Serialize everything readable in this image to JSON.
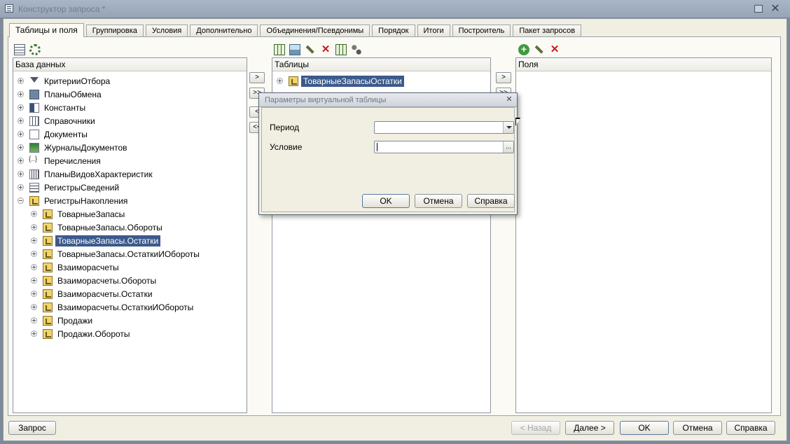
{
  "window": {
    "title": "Конструктор запроса *",
    "close_glyph": "✕"
  },
  "tabs": [
    {
      "label": "Таблицы и поля"
    },
    {
      "label": "Группировка"
    },
    {
      "label": "Условия"
    },
    {
      "label": "Дополнительно"
    },
    {
      "label": "Объединения/Псевдонимы"
    },
    {
      "label": "Порядок"
    },
    {
      "label": "Итоги"
    },
    {
      "label": "Построитель"
    },
    {
      "label": "Пакет запросов"
    }
  ],
  "database_panel": {
    "header": "База данных",
    "items": [
      {
        "label": "КритерииОтбора",
        "icon": "filter-icon"
      },
      {
        "label": "ПланыОбмена",
        "icon": "exchange-plan-icon"
      },
      {
        "label": "Константы",
        "icon": "constants-icon"
      },
      {
        "label": "Справочники",
        "icon": "catalog-icon"
      },
      {
        "label": "Документы",
        "icon": "document-icon"
      },
      {
        "label": "ЖурналыДокументов",
        "icon": "journal-icon"
      },
      {
        "label": "Перечисления",
        "icon": "enum-icon"
      },
      {
        "label": "ПланыВидовХарактеристик",
        "icon": "characteristic-types-icon"
      },
      {
        "label": "РегистрыСведений",
        "icon": "info-register-icon"
      },
      {
        "label": "РегистрыНакопления",
        "icon": "accumulation-register-icon"
      },
      {
        "label": "ТоварныеЗапасы",
        "icon": "accumulation-register-icon"
      },
      {
        "label": "ТоварныеЗапасы.Обороты",
        "icon": "accumulation-register-icon"
      },
      {
        "label": "ТоварныеЗапасы.Остатки",
        "icon": "accumulation-register-icon"
      },
      {
        "label": "ТоварныеЗапасы.ОстаткиИОбороты",
        "icon": "accumulation-register-icon"
      },
      {
        "label": "Взаиморасчеты",
        "icon": "accumulation-register-icon"
      },
      {
        "label": "Взаиморасчеты.Обороты",
        "icon": "accumulation-register-icon"
      },
      {
        "label": "Взаиморасчеты.Остатки",
        "icon": "accumulation-register-icon"
      },
      {
        "label": "Взаиморасчеты.ОстаткиИОбороты",
        "icon": "accumulation-register-icon"
      },
      {
        "label": "Продажи",
        "icon": "accumulation-register-icon"
      },
      {
        "label": "Продажи.Обороты",
        "icon": "accumulation-register-icon"
      }
    ],
    "selected_item": "ТоварныеЗапасы.Остатки"
  },
  "tables_panel": {
    "header": "Таблицы",
    "items": [
      {
        "label": "ТоварныеЗапасыОстатки",
        "icon": "virtual-table-icon"
      }
    ]
  },
  "fields_panel": {
    "header": "Поля"
  },
  "move_buttons": {
    "add": ">",
    "add_all": ">>",
    "remove": "<",
    "remove_all": "<<"
  },
  "dialog": {
    "title": "Параметры виртуальной таблицы",
    "period_label": "Период",
    "period_value": "",
    "condition_label": "Условие",
    "condition_value": "",
    "select_glyph": "...",
    "ok": "OK",
    "cancel": "Отмена",
    "help": "Справка"
  },
  "footer": {
    "query": "Запрос",
    "back": "< Назад",
    "next": "Далее >",
    "ok": "OK",
    "cancel": "Отмена",
    "help": "Справка"
  }
}
